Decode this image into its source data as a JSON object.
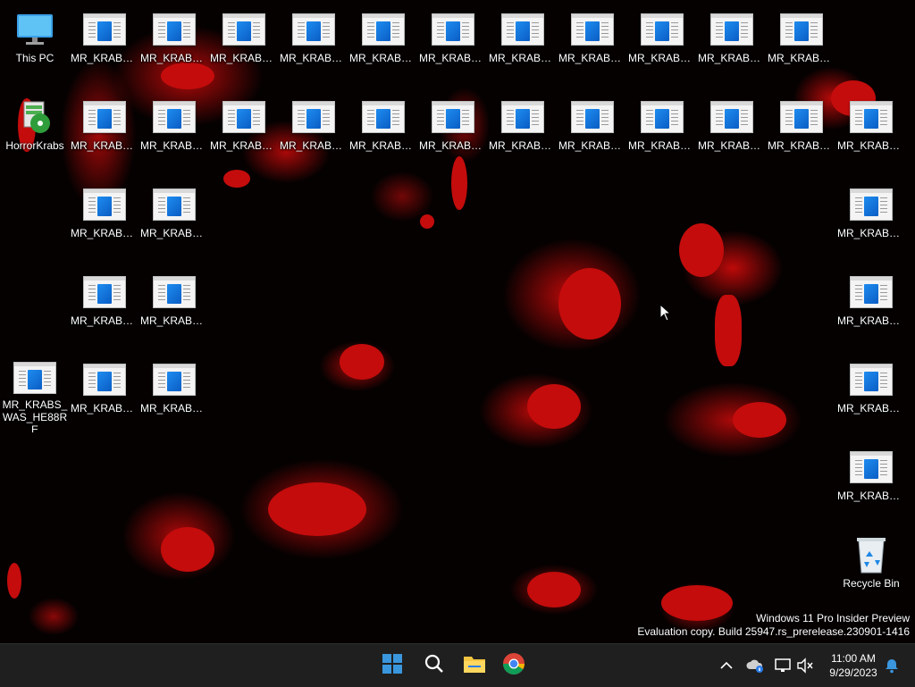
{
  "desktop": {
    "icons": {
      "this_pc": "This PC",
      "horror_krabs": "HorrorKrabs",
      "recycle_bin": "Recycle Bin",
      "mr_krabs_short": "MR_KRABS_...",
      "mr_krabs_full": "MR_KRABS_WAS_HE88RE"
    }
  },
  "watermark": {
    "line1": "Windows 11 Pro Insider Preview",
    "line2": "Evaluation copy. Build 25947.rs_prerelease.230901-1416"
  },
  "taskbar": {
    "items": [
      "start-icon",
      "search-icon",
      "file-explorer-icon",
      "chrome-icon"
    ],
    "clock": {
      "time": "11:00 AM",
      "date": "9/29/2023"
    }
  },
  "colors": {
    "accent_blue": "#0a5dc4",
    "blood_red": "#c40c0c",
    "taskbar": "#1f1f1f"
  }
}
